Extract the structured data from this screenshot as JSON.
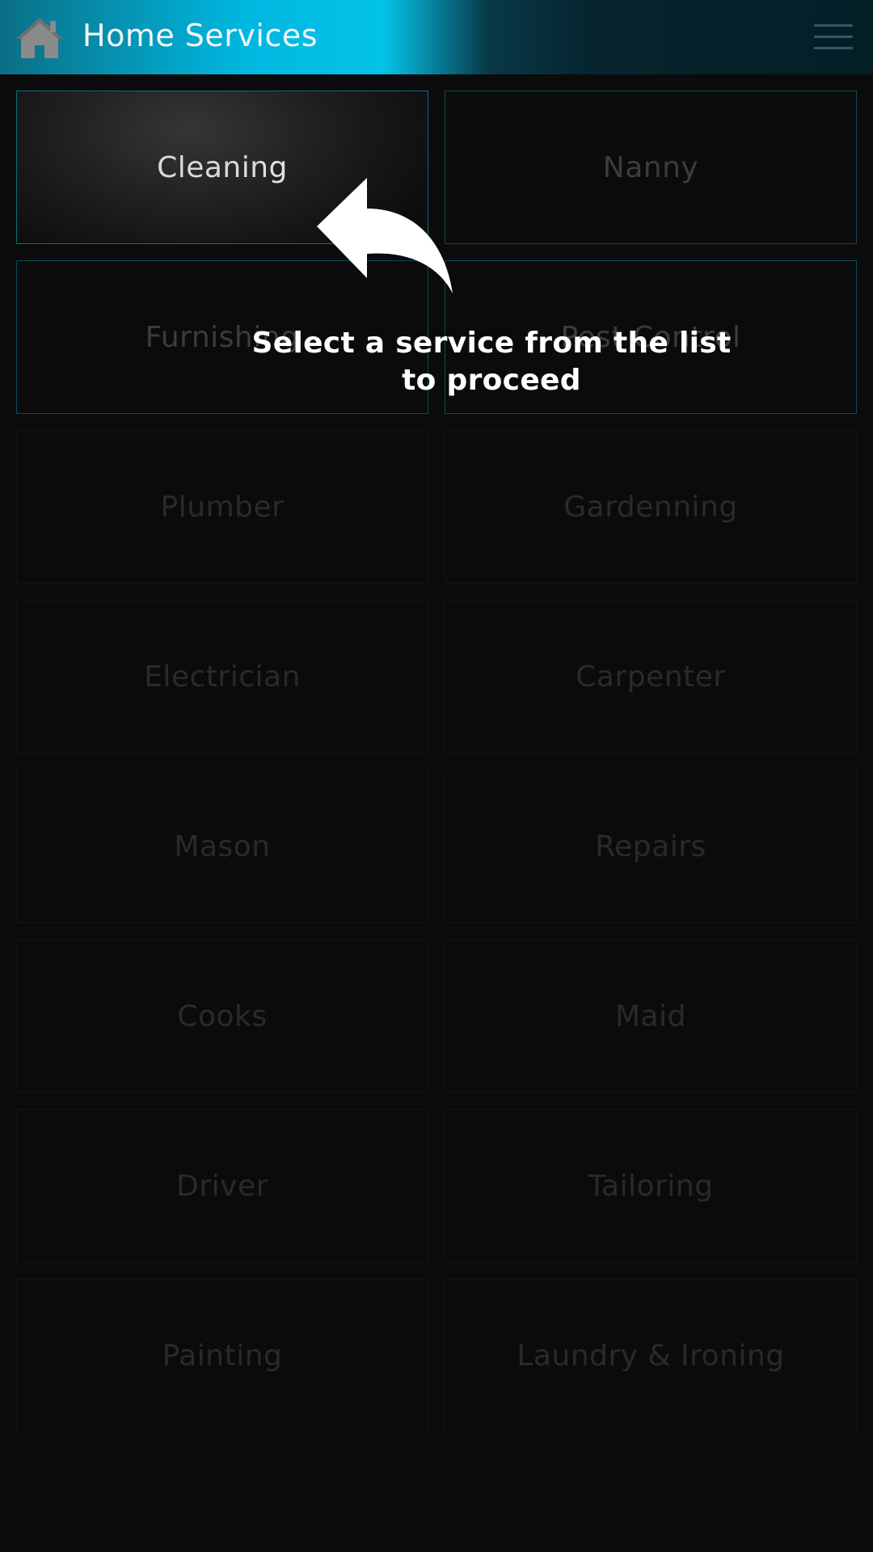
{
  "header": {
    "title": "Home Services",
    "home_icon": "home-icon",
    "menu_icon": "hamburger-menu-icon",
    "colors": {
      "accent": "#00b7e0",
      "dark": "#041e26"
    }
  },
  "services": [
    {
      "label": "Cleaning",
      "state": "highlighted"
    },
    {
      "label": "Nanny",
      "state": "outlined"
    },
    {
      "label": "Furnishing",
      "state": "outlined"
    },
    {
      "label": "Pest Control",
      "state": "outlined"
    },
    {
      "label": "Plumber",
      "state": "dimmed"
    },
    {
      "label": "Gardenning",
      "state": "dimmed"
    },
    {
      "label": "Electrician",
      "state": "dimmed"
    },
    {
      "label": "Carpenter",
      "state": "dimmed"
    },
    {
      "label": "Mason",
      "state": "dimmed"
    },
    {
      "label": "Repairs",
      "state": "dimmed"
    },
    {
      "label": "Cooks",
      "state": "dimmed"
    },
    {
      "label": "Maid",
      "state": "dimmed"
    },
    {
      "label": "Driver",
      "state": "dimmed"
    },
    {
      "label": "Tailoring",
      "state": "dimmed"
    },
    {
      "label": "Painting",
      "state": "dimmed"
    },
    {
      "label": "Laundry & Ironing",
      "state": "dimmed"
    }
  ],
  "overlay": {
    "hint_line1": "Select a service from the list",
    "hint_line2": "to proceed",
    "arrow_icon": "curved-arrow-icon"
  }
}
